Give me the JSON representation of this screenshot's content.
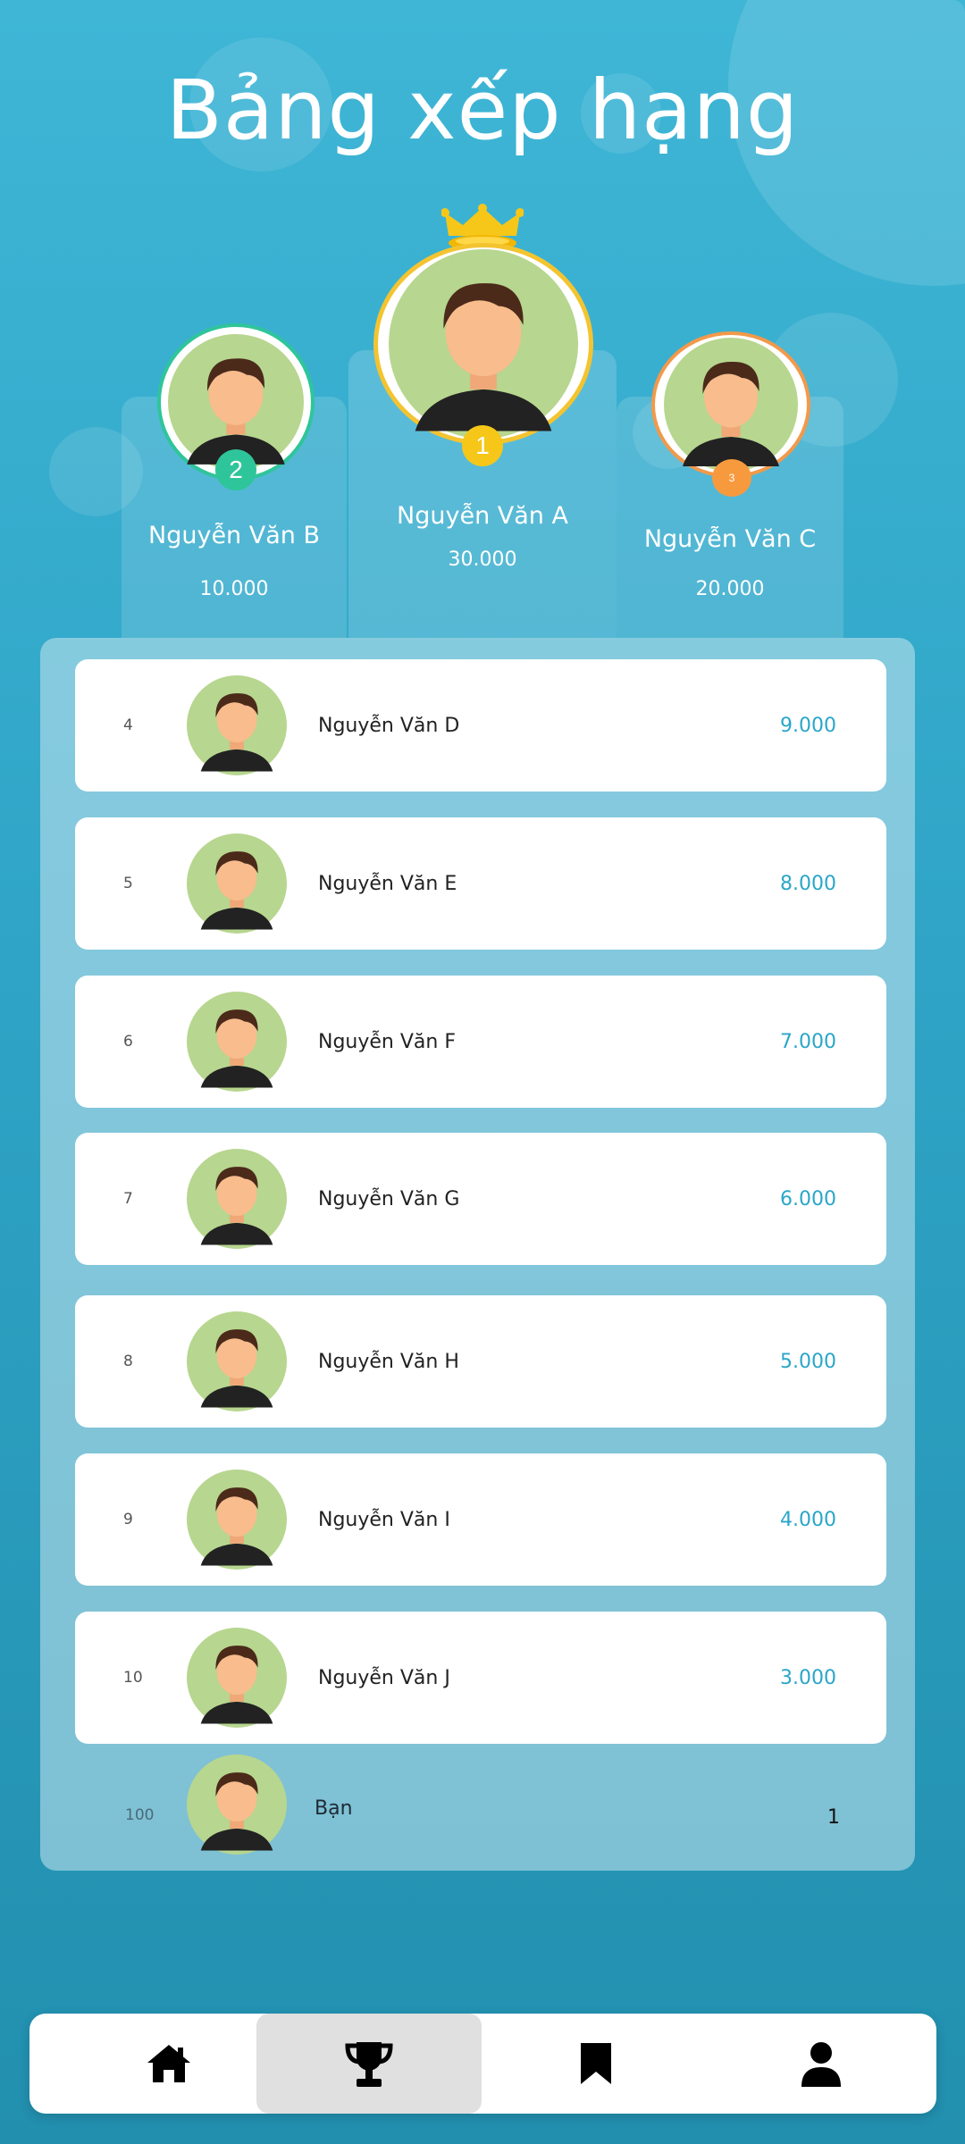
{
  "header": {
    "title": "Bảng xếp hạng"
  },
  "podium": [
    {
      "rank": "2",
      "name": "Nguyễn Văn B",
      "score": "10.000",
      "badge_color": "#2fc59a"
    },
    {
      "rank": "1",
      "name": "Nguyễn Văn A",
      "score": "30.000",
      "badge_color": "#f6c719"
    },
    {
      "rank": "3",
      "name": "Nguyễn Văn C",
      "score": "20.000",
      "badge_color": "#f79a3e"
    }
  ],
  "leaderboard": [
    {
      "rank": "4",
      "name": "Nguyễn Văn D",
      "score": "9.000"
    },
    {
      "rank": "5",
      "name": "Nguyễn Văn E",
      "score": "8.000"
    },
    {
      "rank": "6",
      "name": "Nguyễn Văn F",
      "score": "7.000"
    },
    {
      "rank": "7",
      "name": "Nguyễn Văn G",
      "score": "6.000"
    },
    {
      "rank": "8",
      "name": "Nguyễn Văn H",
      "score": "5.000"
    },
    {
      "rank": "9",
      "name": "Nguyễn Văn I",
      "score": "4.000"
    },
    {
      "rank": "10",
      "name": "Nguyễn Văn J",
      "score": "3.000"
    }
  ],
  "current_user": {
    "rank": "100",
    "name": "Bạn",
    "score": "1"
  },
  "nav": {
    "items": [
      {
        "icon": "home-icon",
        "active": false
      },
      {
        "icon": "trophy-icon",
        "active": true
      },
      {
        "icon": "bookmark-icon",
        "active": false
      },
      {
        "icon": "profile-icon",
        "active": false
      }
    ]
  },
  "colors": {
    "score": "#2aa6c8",
    "crown": "#f6c719",
    "avatar_bg": "#b7d68f"
  }
}
